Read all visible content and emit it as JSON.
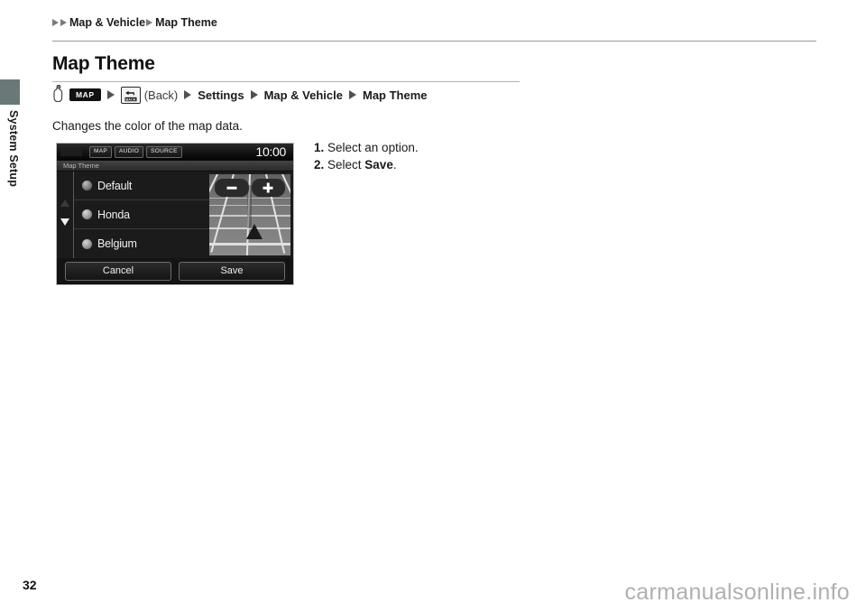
{
  "sidebar": {
    "section_label": "System Setup",
    "tab_color": "#6b7878"
  },
  "breadcrumb_top": {
    "items": [
      "Map & Vehicle",
      "Map Theme"
    ]
  },
  "header": {
    "title": "Map Theme"
  },
  "path": {
    "hand_icon": "hand-pointer-icon",
    "map_key_label": "MAP",
    "back_key_label": "BACK",
    "back_text": "(Back)",
    "steps": [
      "Settings",
      "Map & Vehicle",
      "Map Theme"
    ]
  },
  "description": "Changes the color of the map data.",
  "instructions": [
    {
      "number": "1.",
      "text_before": " Select an option.",
      "bold": "",
      "text_after": ""
    },
    {
      "number": "2.",
      "text_before": " Select ",
      "bold": "Save",
      "text_after": "."
    }
  ],
  "nav_screen": {
    "hardware_buttons": [
      "MAP",
      "AUDIO",
      "SOURCE"
    ],
    "clock": "10:00",
    "screen_title": "Map Theme",
    "options": [
      {
        "label": "Default",
        "selected": true
      },
      {
        "label": "Honda",
        "selected": false
      },
      {
        "label": "Belgium",
        "selected": false
      }
    ],
    "scroll_up_icon": "arrow-up-icon",
    "scroll_down_icon": "arrow-down-icon",
    "zoom_out_label": "zoom-out-icon",
    "zoom_in_label": "zoom-in-icon",
    "footer_buttons": [
      {
        "label": "Cancel"
      },
      {
        "label": "Save"
      }
    ]
  },
  "footer": {
    "page_number": "32",
    "watermark": "carmanualsonline.info"
  }
}
